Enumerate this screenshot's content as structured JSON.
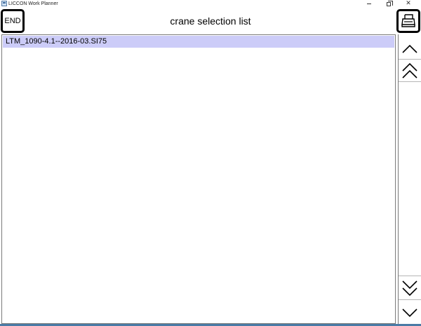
{
  "window": {
    "title": "LICCON Work Planner"
  },
  "header": {
    "end_label": "END",
    "title": "crane selection list"
  },
  "list": {
    "items": [
      {
        "label": "LTM_1090-4.1--2016-03.SI75",
        "selected": true
      }
    ]
  },
  "scroll": {
    "icons": [
      "chevron-up-icon",
      "double-chevron-up-icon",
      "double-chevron-down-icon",
      "chevron-down-icon"
    ]
  },
  "colors": {
    "selection": "#ccccf8",
    "border": "#000000",
    "background": "#ffffff"
  },
  "icons": {
    "print": "printer-icon",
    "app": "app-icon"
  }
}
